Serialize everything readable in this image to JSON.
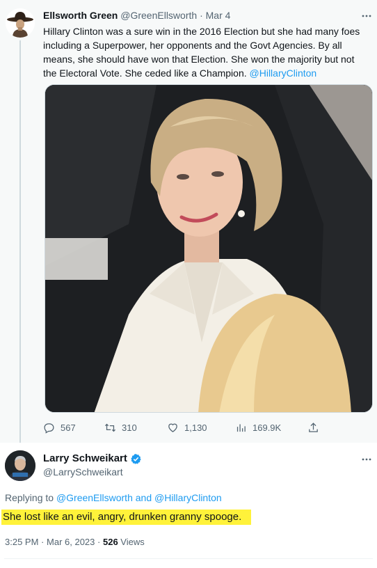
{
  "parent_tweet": {
    "author_name": "Ellsworth Green",
    "author_handle": "@GreenEllsworth",
    "separator": "·",
    "date": "Mar 4",
    "text_main": "Hillary Clinton was a sure win in the 2016 Election but she had many foes including a Superpower, her opponents and the Govt Agencies.  By all means, she should have won that Election.  She won the majority but not the Electoral Vote.  She ceded like a Champion. ",
    "text_mention": "@HillaryClinton",
    "media_icon": "photo",
    "stats": {
      "replies": "567",
      "retweets": "310",
      "likes": "1,130",
      "views": "169.9K"
    },
    "icons": [
      "more-icon",
      "reply-icon",
      "retweet-icon",
      "like-icon",
      "views-icon",
      "share-icon"
    ]
  },
  "reply_tweet": {
    "author_name": "Larry Schweikart",
    "author_handle": "@LarrySchweikart",
    "verified": true,
    "replying_label": "Replying to ",
    "replying_mention_1": "@GreenEllsworth",
    "replying_and": " and ",
    "replying_mention_2": "@HillaryClinton",
    "text": "She lost like an evil, angry, drunken granny spooge.",
    "time": "3:25 PM",
    "separator": "·",
    "date": "Mar 6, 2023",
    "views_count": "526",
    "views_label": " Views"
  },
  "colors": {
    "accent": "#1d9bf0",
    "secondary_text": "#536471",
    "highlight": "#fff23a",
    "parent_background": "#f7f9f9"
  }
}
